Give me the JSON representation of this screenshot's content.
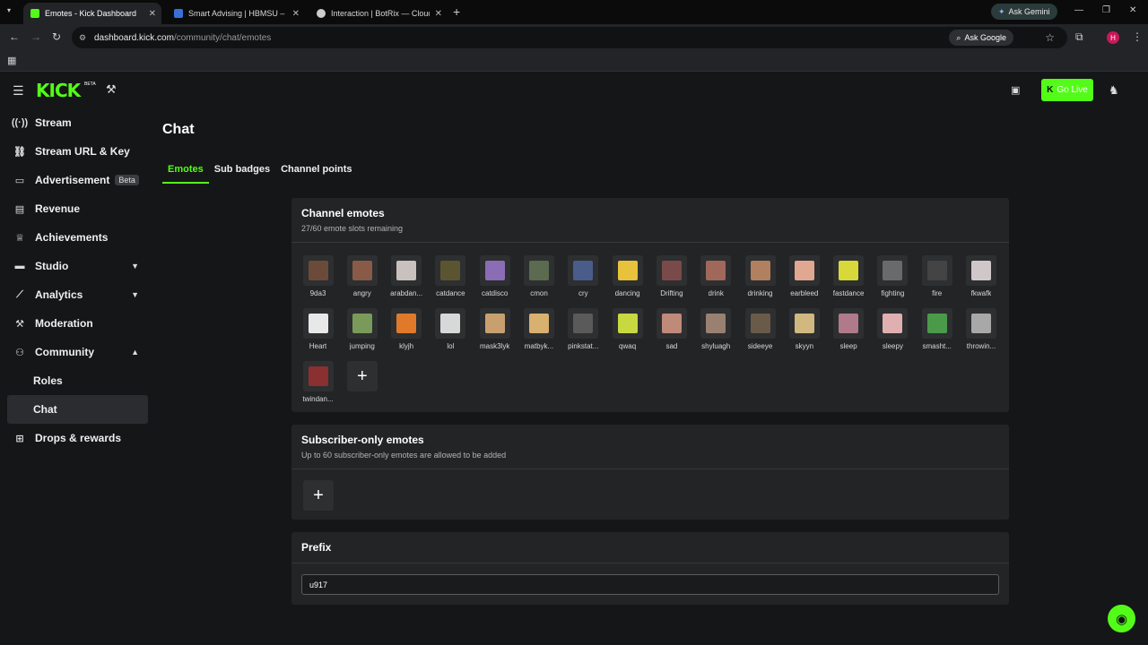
{
  "browser": {
    "tabs": [
      {
        "title": "Emotes - Kick Dashboard",
        "icon": "kick-favicon",
        "color": "#53fc18"
      },
      {
        "title": "Smart Advising | HBMSU – UAE",
        "icon": "hbmsu-favicon",
        "color": "#3a6fd8"
      },
      {
        "title": "Interaction | BotRix — Cloud Stre...",
        "icon": "botrix-favicon",
        "color": "#cccccc"
      }
    ],
    "ask_gemini": "Ask Gemini",
    "url_host": "dashboard.kick.com",
    "url_path": "/community/chat/emotes",
    "ask_google": "Ask Google",
    "profile_initial": "H"
  },
  "header": {
    "logo": "KICK",
    "logo_sup": "BETA",
    "go_live": "Go Live"
  },
  "sidebar": {
    "items": [
      {
        "label": "Stream",
        "icon": "stream-icon"
      },
      {
        "label": "Stream URL & Key",
        "icon": "link-icon"
      },
      {
        "label": "Advertisement",
        "icon": "ad-icon",
        "badge": "Beta"
      },
      {
        "label": "Revenue",
        "icon": "revenue-icon"
      },
      {
        "label": "Achievements",
        "icon": "trophy-icon"
      },
      {
        "label": "Studio",
        "icon": "studio-icon"
      },
      {
        "label": "Analytics",
        "icon": "analytics-icon"
      },
      {
        "label": "Moderation",
        "icon": "hammer-icon"
      },
      {
        "label": "Community",
        "icon": "community-icon"
      },
      {
        "label": "Roles",
        "icon": ""
      },
      {
        "label": "Chat",
        "icon": ""
      },
      {
        "label": "Drops & rewards",
        "icon": "gift-icon"
      }
    ]
  },
  "page": {
    "title": "Chat",
    "tabs": [
      "Emotes",
      "Sub badges",
      "Channel points"
    ]
  },
  "channel_emotes": {
    "title": "Channel emotes",
    "subtitle": "27/60 emote slots remaining",
    "emotes": [
      {
        "name": "9da3",
        "color": "#6b4a3a"
      },
      {
        "name": "angry",
        "color": "#8a5a48"
      },
      {
        "name": "arabdan...",
        "color": "#c9c1bd"
      },
      {
        "name": "catdance",
        "color": "#5a5530"
      },
      {
        "name": "catdisco",
        "color": "#8a6db5"
      },
      {
        "name": "cmon",
        "color": "#5c6a50"
      },
      {
        "name": "cry",
        "color": "#4a5c8a"
      },
      {
        "name": "dancing",
        "color": "#e8c23a"
      },
      {
        "name": "Drifting",
        "color": "#7a4a4a"
      },
      {
        "name": "drink",
        "color": "#a0685a"
      },
      {
        "name": "drinking",
        "color": "#b08060"
      },
      {
        "name": "earbleed",
        "color": "#e0a890"
      },
      {
        "name": "fastdance",
        "color": "#d8d83a"
      },
      {
        "name": "fighting",
        "color": "#6a6a6a"
      },
      {
        "name": "fire",
        "color": "#444444"
      },
      {
        "name": "fkwafk",
        "color": "#d0c8c8"
      },
      {
        "name": "Heart",
        "color": "#e8e8e8"
      },
      {
        "name": "jumping",
        "color": "#7a9a5a"
      },
      {
        "name": "klyjh",
        "color": "#e07a2a"
      },
      {
        "name": "lol",
        "color": "#d8d8d8"
      },
      {
        "name": "mask3lyk",
        "color": "#c8a070"
      },
      {
        "name": "matbyk...",
        "color": "#d8b070"
      },
      {
        "name": "pinkstat...",
        "color": "#5a5a5a"
      },
      {
        "name": "qwaq",
        "color": "#c8d840"
      },
      {
        "name": "sad",
        "color": "#c08a7a"
      },
      {
        "name": "shyluagh",
        "color": "#9a8070"
      },
      {
        "name": "sideeye",
        "color": "#6a5a4a"
      },
      {
        "name": "skyyn",
        "color": "#d0b880"
      },
      {
        "name": "sleep",
        "color": "#b07a8a"
      },
      {
        "name": "sleepy",
        "color": "#e0b0b0"
      },
      {
        "name": "smasht...",
        "color": "#4a9a4a"
      },
      {
        "name": "throwin...",
        "color": "#a8a8a8"
      },
      {
        "name": "twindan...",
        "color": "#8a3030"
      }
    ]
  },
  "subscriber_emotes": {
    "title": "Subscriber-only emotes",
    "subtitle": "Up to 60 subscriber-only emotes are allowed to be added"
  },
  "prefix": {
    "title": "Prefix",
    "value": "u917"
  }
}
